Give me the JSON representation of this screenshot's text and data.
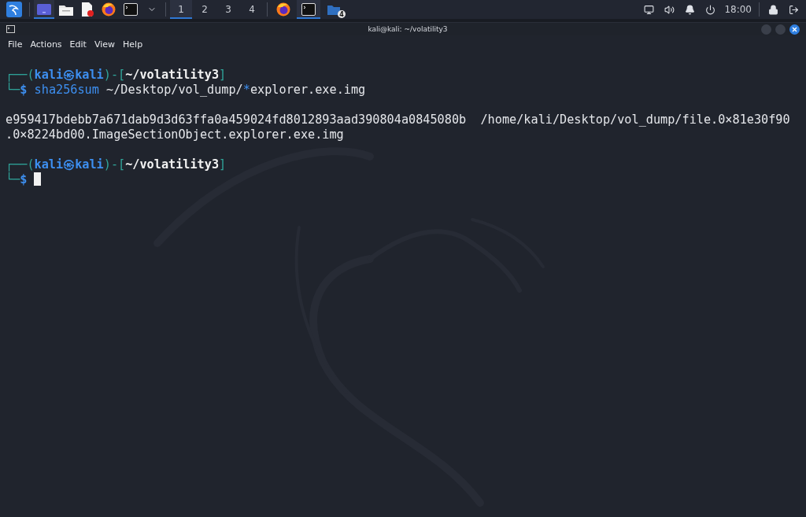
{
  "taskbar": {
    "launchers": [
      {
        "kind": "menu",
        "selected": false
      },
      {
        "kind": "desktop",
        "selected": true
      },
      {
        "kind": "files",
        "selected": false
      },
      {
        "kind": "editor",
        "selected": false
      },
      {
        "kind": "browser",
        "selected": false
      },
      {
        "kind": "terminal",
        "selected": false
      },
      {
        "kind": "dropdown",
        "selected": false
      }
    ],
    "workspaces": [
      {
        "label": "1",
        "selected": true
      },
      {
        "label": "2",
        "selected": false
      },
      {
        "label": "3",
        "selected": false
      },
      {
        "label": "4",
        "selected": false
      }
    ],
    "tasks": [
      {
        "kind": "browser",
        "selected": false
      },
      {
        "kind": "terminal",
        "selected": true
      },
      {
        "kind": "folder",
        "selected": false,
        "badge": "4"
      }
    ],
    "tray": [
      {
        "kind": "network"
      },
      {
        "kind": "volume"
      },
      {
        "kind": "notifications"
      },
      {
        "kind": "power"
      }
    ],
    "clock": "18:00",
    "session": [
      {
        "kind": "lock"
      },
      {
        "kind": "logout"
      }
    ]
  },
  "window": {
    "title": "kali@kali: ~/volatility3",
    "menu": [
      "File",
      "Actions",
      "Edit",
      "View",
      "Help"
    ],
    "lines": [
      {
        "kind": "text",
        "segments": [
          {
            "kind": "frame",
            "text": "┌──("
          },
          {
            "kind": "user",
            "text": "kali㉿kali"
          },
          {
            "kind": "frame",
            "text": ")-["
          },
          {
            "kind": "path",
            "text": "~/volatility3"
          },
          {
            "kind": "frame",
            "text": "]"
          }
        ]
      },
      {
        "kind": "text",
        "segments": [
          {
            "kind": "frame",
            "text": "└─"
          },
          {
            "kind": "user",
            "text": "$"
          },
          {
            "kind": "command",
            "text": " sha256sum"
          },
          {
            "kind": "plain",
            "text": " ~/Desktop/vol_dump/"
          },
          {
            "kind": "command",
            "text": "*"
          },
          {
            "kind": "plain",
            "text": "explorer.exe.img"
          }
        ]
      },
      {
        "kind": "blank"
      },
      {
        "kind": "text",
        "segments": [
          {
            "kind": "plain",
            "text": "e959417bdebb7a671dab9d3d63ffa0a459024fd8012893aad390804a0845080b  /home/kali/Desktop/vol_dump/file.0×81e30f90"
          }
        ]
      },
      {
        "kind": "text",
        "segments": [
          {
            "kind": "plain",
            "text": ".0×8224bd00.ImageSectionObject.explorer.exe.img"
          }
        ]
      },
      {
        "kind": "blank"
      },
      {
        "kind": "text",
        "segments": [
          {
            "kind": "frame",
            "text": "┌──("
          },
          {
            "kind": "user",
            "text": "kali㉿kali"
          },
          {
            "kind": "frame",
            "text": ")-["
          },
          {
            "kind": "path",
            "text": "~/volatility3"
          },
          {
            "kind": "frame",
            "text": "]"
          }
        ]
      },
      {
        "kind": "text",
        "cursor": true,
        "segments": [
          {
            "kind": "frame",
            "text": "└─"
          },
          {
            "kind": "user",
            "text": "$"
          }
        ]
      }
    ]
  }
}
